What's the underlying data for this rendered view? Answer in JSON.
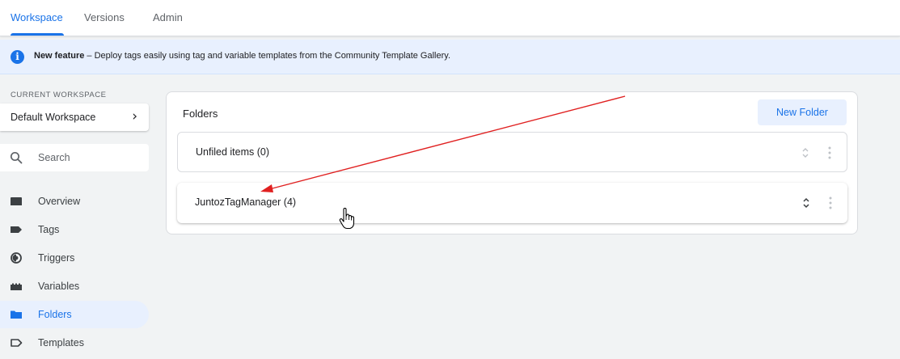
{
  "tabs": [
    {
      "label": "Workspace",
      "active": true
    },
    {
      "label": "Versions",
      "active": false
    },
    {
      "label": "Admin",
      "active": false
    }
  ],
  "banner": {
    "icon": "info-icon",
    "strong": "New feature",
    "text": " – Deploy tags easily using tag and variable templates from the Community Template Gallery."
  },
  "sidebar": {
    "workspace_caption": "CURRENT WORKSPACE",
    "workspace_name": "Default Workspace",
    "search_placeholder": "Search",
    "items": [
      {
        "label": "Overview",
        "icon": "overview-icon",
        "active": false
      },
      {
        "label": "Tags",
        "icon": "tag-icon",
        "active": false
      },
      {
        "label": "Triggers",
        "icon": "trigger-icon",
        "active": false
      },
      {
        "label": "Variables",
        "icon": "variables-icon",
        "active": false
      },
      {
        "label": "Folders",
        "icon": "folder-icon",
        "active": true
      },
      {
        "label": "Templates",
        "icon": "template-icon",
        "active": false
      }
    ]
  },
  "main": {
    "title": "Folders",
    "new_folder_label": "New Folder",
    "folders": [
      {
        "name": "Unfiled items (0)"
      },
      {
        "name": "JuntozTagManager (4)"
      }
    ]
  },
  "colors": {
    "accent": "#1a73e8",
    "banner_bg": "#e8f0fe",
    "annotation_arrow": "#e02020"
  }
}
